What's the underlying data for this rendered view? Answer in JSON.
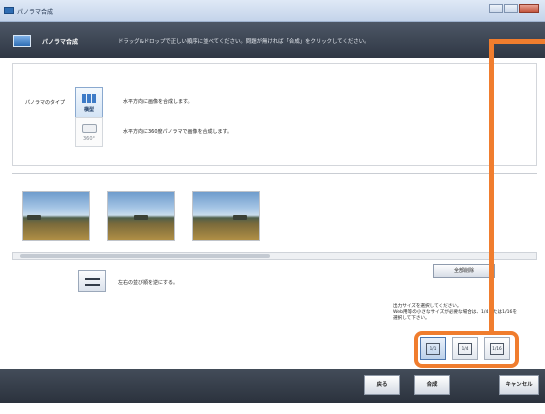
{
  "window": {
    "title": "パノラマ合成"
  },
  "header": {
    "title": "パノラマ合成",
    "description": "ドラッグ&ドロップで正しい順序に並べてください。問題が無ければ「合成」をクリックしてください。"
  },
  "panorama_type": {
    "label": "パノラマのタイプ",
    "options": [
      {
        "caption": "横型",
        "description": "水平方向に画像を合成します。",
        "selected": true
      },
      {
        "caption": "360°",
        "description": "水平方向に360度パノラマで画像を合成します。",
        "selected": false
      }
    ]
  },
  "images": {
    "count": 3
  },
  "reverse": {
    "label": "左右の並び順を逆にする。"
  },
  "delete_all": {
    "label": "全部削除"
  },
  "output_size": {
    "info_lines": [
      "出力サイズを選択してください。",
      "Web用等の小さなサイズが必要な場合は、1/4または1/16を",
      "選択して下さい。"
    ],
    "options": [
      "1/1",
      "1/4",
      "1/16"
    ],
    "selected": "1/1"
  },
  "footer": {
    "back": "戻る",
    "compose": "合成",
    "cancel": "キャンセル"
  },
  "colors": {
    "annotation": "#f07d2e",
    "header_bg": "#3a4350",
    "footer_bg": "#363e4a"
  }
}
